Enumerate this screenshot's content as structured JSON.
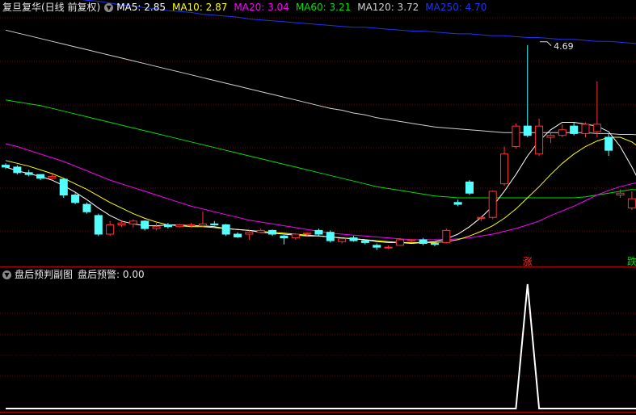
{
  "main_header": {
    "stock_title": "复旦复华(日线 前复权)",
    "settings_icon": "chevron-down-icon",
    "ma_items": [
      {
        "label": "MA5: 2.85",
        "color": "#ffffff"
      },
      {
        "label": "MA10: 2.87",
        "color": "#ffff00"
      },
      {
        "label": "MA20: 3.04",
        "color": "#ff00ff"
      },
      {
        "label": "MA60: 3.21",
        "color": "#00e000"
      },
      {
        "label": "MA120: 3.72",
        "color": "#d0d0d0"
      },
      {
        "label": "MA250: 4.70",
        "color": "#2233ee"
      }
    ]
  },
  "sub_header": {
    "indicator_name": "盘后预判副图",
    "value_label": "盘后预警: 0.00"
  },
  "colors": {
    "background": "#000000",
    "up": "#ff3333",
    "down": "#54ffff",
    "grid": "#7a0000",
    "divider": "#b00000",
    "signal": "#ffffff"
  },
  "chart_data": [
    {
      "type": "candlestick",
      "title": "复旦复华(日线 前复权)",
      "ylim": [
        2.4,
        5.0
      ],
      "annotations": [
        {
          "text": "4.69",
          "value": 4.69,
          "index": 46
        },
        {
          "text": "涨",
          "index": 45,
          "color": "#ff3333"
        },
        {
          "text": "跌",
          "index": 54,
          "color": "#00e000"
        }
      ],
      "candles": [
        {
          "o": 3.4,
          "h": 3.42,
          "l": 3.36,
          "c": 3.38
        },
        {
          "o": 3.38,
          "h": 3.4,
          "l": 3.3,
          "c": 3.32
        },
        {
          "o": 3.32,
          "h": 3.35,
          "l": 3.28,
          "c": 3.3
        },
        {
          "o": 3.3,
          "h": 3.3,
          "l": 3.24,
          "c": 3.26
        },
        {
          "o": 3.26,
          "h": 3.3,
          "l": 3.24,
          "c": 3.28
        },
        {
          "o": 3.25,
          "h": 3.26,
          "l": 3.05,
          "c": 3.08
        },
        {
          "o": 3.08,
          "h": 3.1,
          "l": 2.98,
          "c": 3.0
        },
        {
          "o": 2.98,
          "h": 3.0,
          "l": 2.88,
          "c": 2.9
        },
        {
          "o": 2.86,
          "h": 2.88,
          "l": 2.64,
          "c": 2.66
        },
        {
          "o": 2.66,
          "h": 2.8,
          "l": 2.64,
          "c": 2.76
        },
        {
          "o": 2.76,
          "h": 2.8,
          "l": 2.74,
          "c": 2.78
        },
        {
          "o": 2.77,
          "h": 2.82,
          "l": 2.73,
          "c": 2.8
        },
        {
          "o": 2.8,
          "h": 2.81,
          "l": 2.7,
          "c": 2.72
        },
        {
          "o": 2.72,
          "h": 2.78,
          "l": 2.7,
          "c": 2.74
        },
        {
          "o": 2.76,
          "h": 2.78,
          "l": 2.72,
          "c": 2.74
        },
        {
          "o": 2.74,
          "h": 2.77,
          "l": 2.73,
          "c": 2.76
        },
        {
          "o": 2.75,
          "h": 2.78,
          "l": 2.73,
          "c": 2.76
        },
        {
          "o": 2.75,
          "h": 2.9,
          "l": 2.74,
          "c": 2.77
        },
        {
          "o": 2.77,
          "h": 2.8,
          "l": 2.75,
          "c": 2.76
        },
        {
          "o": 2.76,
          "h": 2.77,
          "l": 2.64,
          "c": 2.66
        },
        {
          "o": 2.66,
          "h": 2.68,
          "l": 2.62,
          "c": 2.63
        },
        {
          "o": 2.66,
          "h": 2.7,
          "l": 2.6,
          "c": 2.68
        },
        {
          "o": 2.68,
          "h": 2.72,
          "l": 2.67,
          "c": 2.7
        },
        {
          "o": 2.7,
          "h": 2.71,
          "l": 2.64,
          "c": 2.66
        },
        {
          "o": 2.64,
          "h": 2.65,
          "l": 2.55,
          "c": 2.62
        },
        {
          "o": 2.62,
          "h": 2.67,
          "l": 2.6,
          "c": 2.66
        },
        {
          "o": 2.66,
          "h": 2.68,
          "l": 2.64,
          "c": 2.67
        },
        {
          "o": 2.7,
          "h": 2.72,
          "l": 2.64,
          "c": 2.66
        },
        {
          "o": 2.68,
          "h": 2.7,
          "l": 2.57,
          "c": 2.59
        },
        {
          "o": 2.58,
          "h": 2.62,
          "l": 2.56,
          "c": 2.61
        },
        {
          "o": 2.62,
          "h": 2.64,
          "l": 2.58,
          "c": 2.59
        },
        {
          "o": 2.59,
          "h": 2.6,
          "l": 2.55,
          "c": 2.57
        },
        {
          "o": 2.54,
          "h": 2.56,
          "l": 2.49,
          "c": 2.52
        },
        {
          "o": 2.52,
          "h": 2.54,
          "l": 2.5,
          "c": 2.52
        },
        {
          "o": 2.54,
          "h": 2.62,
          "l": 2.54,
          "c": 2.6
        },
        {
          "o": 2.59,
          "h": 2.61,
          "l": 2.57,
          "c": 2.6
        },
        {
          "o": 2.6,
          "h": 2.62,
          "l": 2.54,
          "c": 2.56
        },
        {
          "o": 2.56,
          "h": 2.58,
          "l": 2.53,
          "c": 2.55
        },
        {
          "o": 2.57,
          "h": 2.72,
          "l": 2.56,
          "c": 2.7
        },
        {
          "o": 3.0,
          "h": 3.03,
          "l": 2.96,
          "c": 2.98
        },
        {
          "o": 3.22,
          "h": 3.24,
          "l": 3.08,
          "c": 3.1
        },
        {
          "o": 2.83,
          "h": 2.85,
          "l": 2.8,
          "c": 2.84
        },
        {
          "o": 2.84,
          "h": 3.13,
          "l": 2.82,
          "c": 3.12
        },
        {
          "o": 3.2,
          "h": 3.6,
          "l": 3.18,
          "c": 3.52
        },
        {
          "o": 3.6,
          "h": 3.85,
          "l": 3.58,
          "c": 3.82
        },
        {
          "o": 3.82,
          "h": 4.69,
          "l": 3.7,
          "c": 3.72
        },
        {
          "o": 3.52,
          "h": 3.9,
          "l": 3.5,
          "c": 3.82
        },
        {
          "o": 3.7,
          "h": 3.76,
          "l": 3.64,
          "c": 3.72
        },
        {
          "o": 3.72,
          "h": 3.84,
          "l": 3.7,
          "c": 3.78
        },
        {
          "o": 3.82,
          "h": 3.86,
          "l": 3.72,
          "c": 3.74
        },
        {
          "o": 3.74,
          "h": 3.86,
          "l": 3.7,
          "c": 3.84
        },
        {
          "o": 3.76,
          "h": 4.3,
          "l": 3.7,
          "c": 3.84
        },
        {
          "o": 3.7,
          "h": 3.74,
          "l": 3.5,
          "c": 3.56
        },
        {
          "o": 3.08,
          "h": 3.14,
          "l": 3.05,
          "c": 3.1
        },
        {
          "o": 2.94,
          "h": 3.12,
          "l": 2.92,
          "c": 3.04
        },
        {
          "o": 2.96,
          "h": 3.0,
          "l": 2.88,
          "c": 2.9
        }
      ],
      "series": [
        {
          "name": "MA250",
          "color": "#2233ee",
          "values": [
            5.3,
            5.28,
            5.26,
            5.25,
            5.23,
            5.21,
            5.19,
            5.17,
            5.16,
            5.14,
            5.12,
            5.11,
            5.09,
            5.08,
            5.06,
            5.05,
            5.04,
            5.02,
            5.01,
            5.0,
            4.99,
            4.97,
            4.96,
            4.95,
            4.94,
            4.93,
            4.92,
            4.91,
            4.9,
            4.89,
            4.88,
            4.88,
            4.87,
            4.86,
            4.85,
            4.84,
            4.84,
            4.83,
            4.82,
            4.81,
            4.81,
            4.8,
            4.79,
            4.79,
            4.78,
            4.77,
            4.77,
            4.76,
            4.75,
            4.75,
            4.74,
            4.73,
            4.73,
            4.72,
            4.71,
            4.7
          ]
        },
        {
          "name": "MA120",
          "color": "#d0d0d0",
          "values": [
            4.85,
            4.82,
            4.79,
            4.76,
            4.73,
            4.7,
            4.67,
            4.64,
            4.61,
            4.58,
            4.55,
            4.52,
            4.49,
            4.46,
            4.43,
            4.4,
            4.37,
            4.34,
            4.31,
            4.28,
            4.25,
            4.22,
            4.19,
            4.16,
            4.13,
            4.1,
            4.07,
            4.04,
            4.01,
            3.99,
            3.96,
            3.94,
            3.91,
            3.89,
            3.87,
            3.85,
            3.83,
            3.81,
            3.8,
            3.79,
            3.78,
            3.77,
            3.76,
            3.75,
            3.75,
            3.75,
            3.75,
            3.75,
            3.75,
            3.75,
            3.75,
            3.74,
            3.74,
            3.73,
            3.73,
            3.72
          ]
        },
        {
          "name": "MA60",
          "color": "#00e000",
          "values": [
            4.1,
            4.08,
            4.06,
            4.04,
            4.01,
            3.98,
            3.95,
            3.92,
            3.89,
            3.86,
            3.83,
            3.8,
            3.77,
            3.74,
            3.71,
            3.68,
            3.65,
            3.62,
            3.59,
            3.56,
            3.53,
            3.5,
            3.47,
            3.44,
            3.41,
            3.38,
            3.35,
            3.32,
            3.29,
            3.26,
            3.23,
            3.2,
            3.17,
            3.15,
            3.13,
            3.11,
            3.09,
            3.07,
            3.06,
            3.05,
            3.05,
            3.05,
            3.05,
            3.05,
            3.05,
            3.05,
            3.05,
            3.05,
            3.05,
            3.05,
            3.06,
            3.08,
            3.1,
            3.12,
            3.14,
            3.13
          ]
        },
        {
          "name": "MA20",
          "color": "#ff00ff",
          "values": [
            3.63,
            3.6,
            3.56,
            3.52,
            3.48,
            3.44,
            3.39,
            3.34,
            3.29,
            3.24,
            3.2,
            3.16,
            3.12,
            3.08,
            3.04,
            3.0,
            2.96,
            2.93,
            2.9,
            2.87,
            2.84,
            2.81,
            2.79,
            2.77,
            2.75,
            2.73,
            2.71,
            2.69,
            2.67,
            2.66,
            2.65,
            2.64,
            2.63,
            2.62,
            2.61,
            2.6,
            2.6,
            2.6,
            2.6,
            2.61,
            2.62,
            2.64,
            2.66,
            2.69,
            2.72,
            2.76,
            2.8,
            2.86,
            2.91,
            2.96,
            3.02,
            3.08,
            3.13,
            3.17,
            3.2,
            3.23
          ]
        },
        {
          "name": "MA10",
          "color": "#ffff00",
          "values": [
            3.45,
            3.42,
            3.39,
            3.35,
            3.31,
            3.26,
            3.2,
            3.14,
            3.07,
            3.0,
            2.94,
            2.88,
            2.83,
            2.79,
            2.76,
            2.75,
            2.74,
            2.74,
            2.73,
            2.72,
            2.71,
            2.7,
            2.69,
            2.68,
            2.67,
            2.66,
            2.65,
            2.64,
            2.63,
            2.62,
            2.61,
            2.6,
            2.59,
            2.58,
            2.57,
            2.57,
            2.57,
            2.57,
            2.58,
            2.6,
            2.64,
            2.69,
            2.75,
            2.83,
            2.93,
            3.05,
            3.17,
            3.3,
            3.42,
            3.52,
            3.6,
            3.66,
            3.7,
            3.7,
            3.65,
            3.56
          ]
        },
        {
          "name": "MA5",
          "color": "#ffffff",
          "values": [
            3.38,
            3.34,
            3.31,
            3.28,
            3.24,
            3.18,
            3.11,
            3.03,
            2.94,
            2.86,
            2.8,
            2.77,
            2.75,
            2.75,
            2.76,
            2.76,
            2.75,
            2.75,
            2.74,
            2.72,
            2.71,
            2.7,
            2.68,
            2.67,
            2.66,
            2.65,
            2.64,
            2.64,
            2.63,
            2.62,
            2.61,
            2.6,
            2.58,
            2.57,
            2.57,
            2.56,
            2.57,
            2.58,
            2.61,
            2.66,
            2.74,
            2.84,
            2.96,
            3.12,
            3.3,
            3.5,
            3.66,
            3.78,
            3.86,
            3.86,
            3.84,
            3.82,
            3.76,
            3.6,
            3.38,
            3.14
          ]
        }
      ]
    },
    {
      "type": "line",
      "title": "盘后预判副图",
      "ylim": [
        0,
        1
      ],
      "series": [
        {
          "name": "盘后预警",
          "color": "#ffffff",
          "values": [
            0,
            0,
            0,
            0,
            0,
            0,
            0,
            0,
            0,
            0,
            0,
            0,
            0,
            0,
            0,
            0,
            0,
            0,
            0,
            0,
            0,
            0,
            0,
            0,
            0,
            0,
            0,
            0,
            0,
            0,
            0,
            0,
            0,
            0,
            0,
            0,
            0,
            0,
            0,
            0,
            0,
            0,
            0,
            0,
            0,
            1,
            0,
            0,
            0,
            0,
            0,
            0,
            0,
            0,
            0,
            0
          ]
        }
      ]
    }
  ]
}
